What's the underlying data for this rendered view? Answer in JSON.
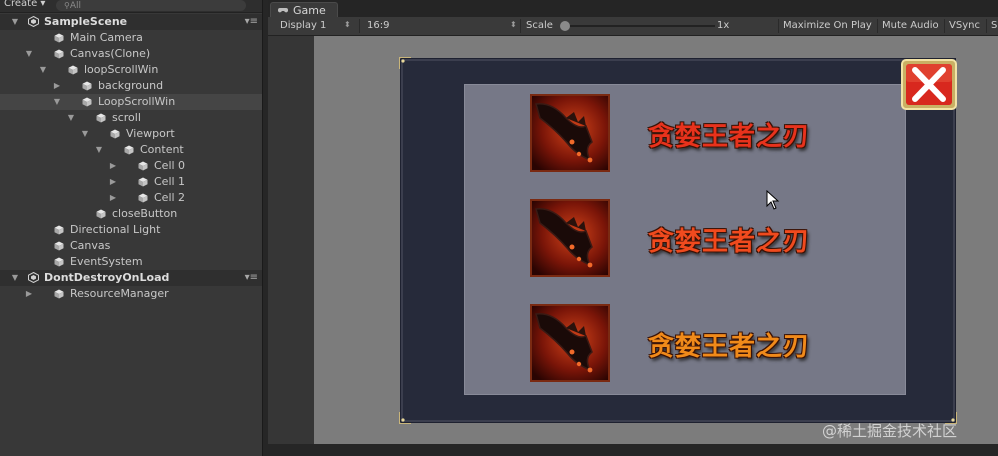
{
  "hierarchy": {
    "create_label": "Create",
    "search_placeholder": "All",
    "rows": [
      {
        "label": "SampleScene",
        "kind": "scene",
        "depth": 0,
        "arrow": "down",
        "menu": "▾≡"
      },
      {
        "label": "Main Camera",
        "kind": "object",
        "depth": 1,
        "arrow": ""
      },
      {
        "label": "Canvas(Clone)",
        "kind": "object",
        "depth": 1,
        "arrow": "down"
      },
      {
        "label": "loopScrollWin",
        "kind": "object",
        "depth": 2,
        "arrow": "down"
      },
      {
        "label": "background",
        "kind": "object",
        "depth": 3,
        "arrow": "right"
      },
      {
        "label": "LoopScrollWin",
        "kind": "object",
        "depth": 3,
        "arrow": "down",
        "selected": true
      },
      {
        "label": "scroll",
        "kind": "object",
        "depth": 4,
        "arrow": "down"
      },
      {
        "label": "Viewport",
        "kind": "object",
        "depth": 5,
        "arrow": "down"
      },
      {
        "label": "Content",
        "kind": "object",
        "depth": 6,
        "arrow": "down"
      },
      {
        "label": "Cell 0",
        "kind": "object",
        "depth": 7,
        "arrow": "right"
      },
      {
        "label": "Cell 1",
        "kind": "object",
        "depth": 7,
        "arrow": "right"
      },
      {
        "label": "Cell 2",
        "kind": "object",
        "depth": 7,
        "arrow": "right"
      },
      {
        "label": "closeButton",
        "kind": "object",
        "depth": 4,
        "arrow": ""
      },
      {
        "label": "Directional Light",
        "kind": "object",
        "depth": 1,
        "arrow": ""
      },
      {
        "label": "Canvas",
        "kind": "object",
        "depth": 1,
        "arrow": ""
      },
      {
        "label": "EventSystem",
        "kind": "object",
        "depth": 1,
        "arrow": ""
      },
      {
        "label": "DontDestroyOnLoad",
        "kind": "scene",
        "depth": 0,
        "arrow": "down",
        "menu": "▾≡"
      },
      {
        "label": "ResourceManager",
        "kind": "object",
        "depth": 1,
        "arrow": "right"
      }
    ]
  },
  "game_tab": {
    "label": "Game"
  },
  "game_toolbar": {
    "display": "Display 1",
    "aspect": "16:9",
    "scale_label": "Scale",
    "scale_value": "1x",
    "maximize": "Maximize On Play",
    "mute": "Mute Audio",
    "vsync": "VSync",
    "stats": "S"
  },
  "window": {
    "cells": [
      {
        "name": "贪婪王者之刃",
        "color": "#e8321c"
      },
      {
        "name": "贪婪王者之刃",
        "color": "#f04a1e"
      },
      {
        "name": "贪婪王者之刃",
        "color": "#f08a1a"
      }
    ]
  },
  "watermark": "@稀土掘金技术社区",
  "colors": {
    "panel": "#383838",
    "window_frame": "#262a3a",
    "window_inner": "#767887",
    "close_red": "#d8281e"
  }
}
